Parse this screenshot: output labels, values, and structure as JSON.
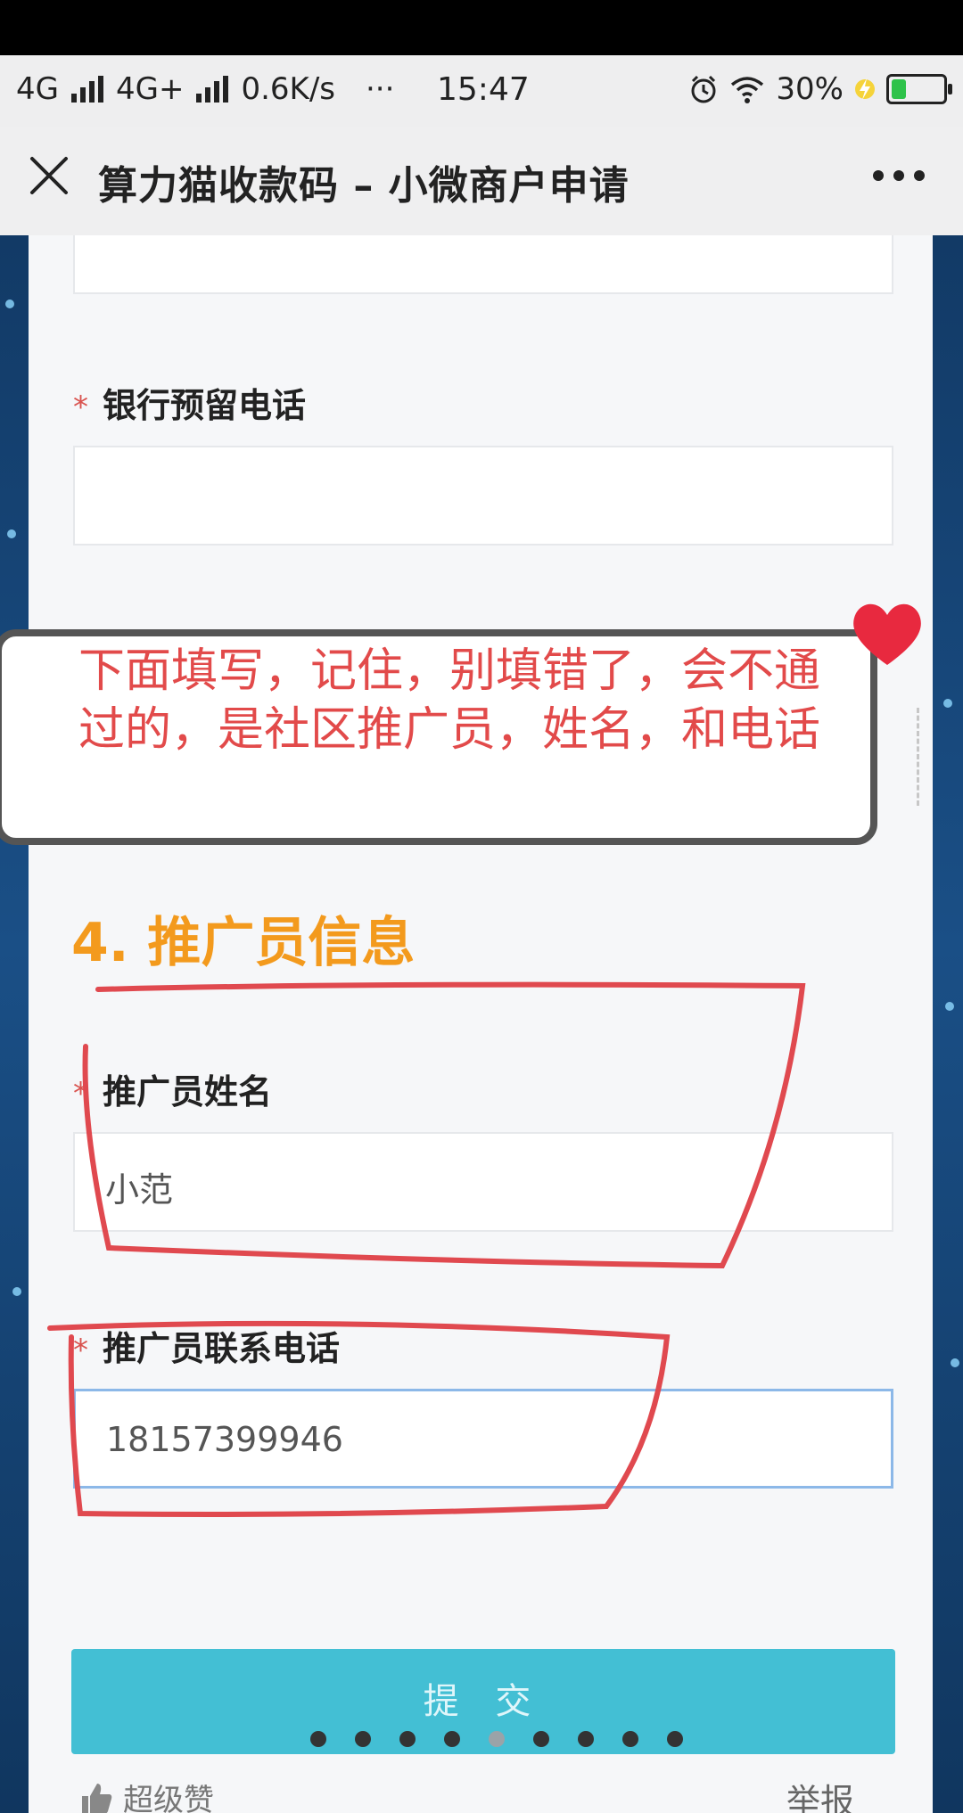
{
  "status_bar": {
    "network_1": "4G",
    "network_2": "4G+",
    "speed": "0.6K/s",
    "dots": "···",
    "time": "15:47",
    "battery_percent": "30%",
    "battery_level": 0.3,
    "icons": [
      "signal-bars-icon",
      "alarm-icon",
      "wifi-icon",
      "charging-bolt-icon",
      "battery-icon"
    ]
  },
  "nav_bar": {
    "title": "算力猫收款码 – 小微商户申请",
    "close_icon": "close-icon",
    "more_icon": "more-dots-icon"
  },
  "form": {
    "bank_phone_label": "银行预留电话",
    "bank_phone_value": "",
    "required_mark": "*",
    "section_title": "4. 推广员信息",
    "promoter_name_label": "推广员姓名",
    "promoter_name_value": "小范",
    "promoter_phone_label": "推广员联系电话",
    "promoter_phone_value": "18157399946",
    "submit_label": "提 交"
  },
  "annotation": {
    "bubble_text": "下面填写，记住，别填错了，会不通过的，是社区推广员，姓名，和电话",
    "colors": {
      "marker": "#e0494f",
      "bubble_border": "#555555"
    }
  },
  "carousel": {
    "count": 9,
    "active_index": 4
  },
  "footer": {
    "like_label": "超级赞",
    "report_label": "举报"
  },
  "colors": {
    "section_accent": "#f39a1d",
    "submit_bg": "#43bfd4",
    "required": "#d9534f"
  }
}
